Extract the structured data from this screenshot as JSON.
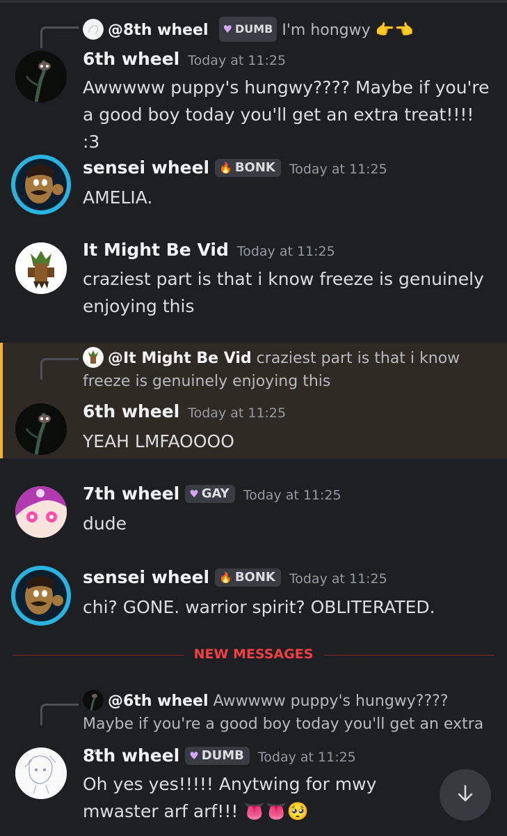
{
  "messages": [
    {
      "reply": {
        "name": "@8th wheel",
        "badge": "DUMB",
        "text": "I'm hongwy",
        "emoji": "👉👈"
      },
      "author": "6th wheel",
      "time": "Today at 11:25",
      "text": "Awwwww puppy's hungwy???? Maybe if you're a good boy today you'll get an extra treat!!!! :3"
    },
    {
      "author": "sensei wheel",
      "badge": "BONK",
      "time": "Today at 11:25",
      "text": "AMELIA."
    },
    {
      "author": "It Might Be Vid",
      "time": "Today at 11:25",
      "text": "craziest part is that i know freeze is genuinely enjoying this"
    },
    {
      "reply": {
        "name": "@It Might Be Vid",
        "text": "craziest part is that i know freeze is genuinely enjoying this"
      },
      "author": "6th wheel",
      "time": "Today at 11:25",
      "text": "YEAH LMFAOOOO"
    },
    {
      "author": "7th wheel",
      "badge": "GAY",
      "time": "Today at 11:25",
      "text": "dude"
    },
    {
      "author": "sensei wheel",
      "badge": "BONK",
      "time": "Today at 11:25",
      "text": "chi? GONE. warrior spirit? OBLITERATED."
    },
    {
      "reply": {
        "name": "@6th wheel",
        "text": "Awwwww puppy's hungwy???? Maybe if you're a good boy today you'll get an extra ..."
      },
      "author": "8th wheel",
      "badge": "DUMB",
      "time": "Today at 11:25",
      "text": "Oh yes yes!!!!! Anytwing for mwy mwaster arf arf!!!",
      "emoji": "👅👅🥺"
    }
  ],
  "divider": "NEW MESSAGES",
  "icons": {
    "scroll_down": "arrow-down-icon"
  },
  "colors": {
    "bg": "#1e1f22",
    "highlight": "#2f2b24",
    "highlight_bar": "#f0b232",
    "new_messages": "#f23f43"
  }
}
